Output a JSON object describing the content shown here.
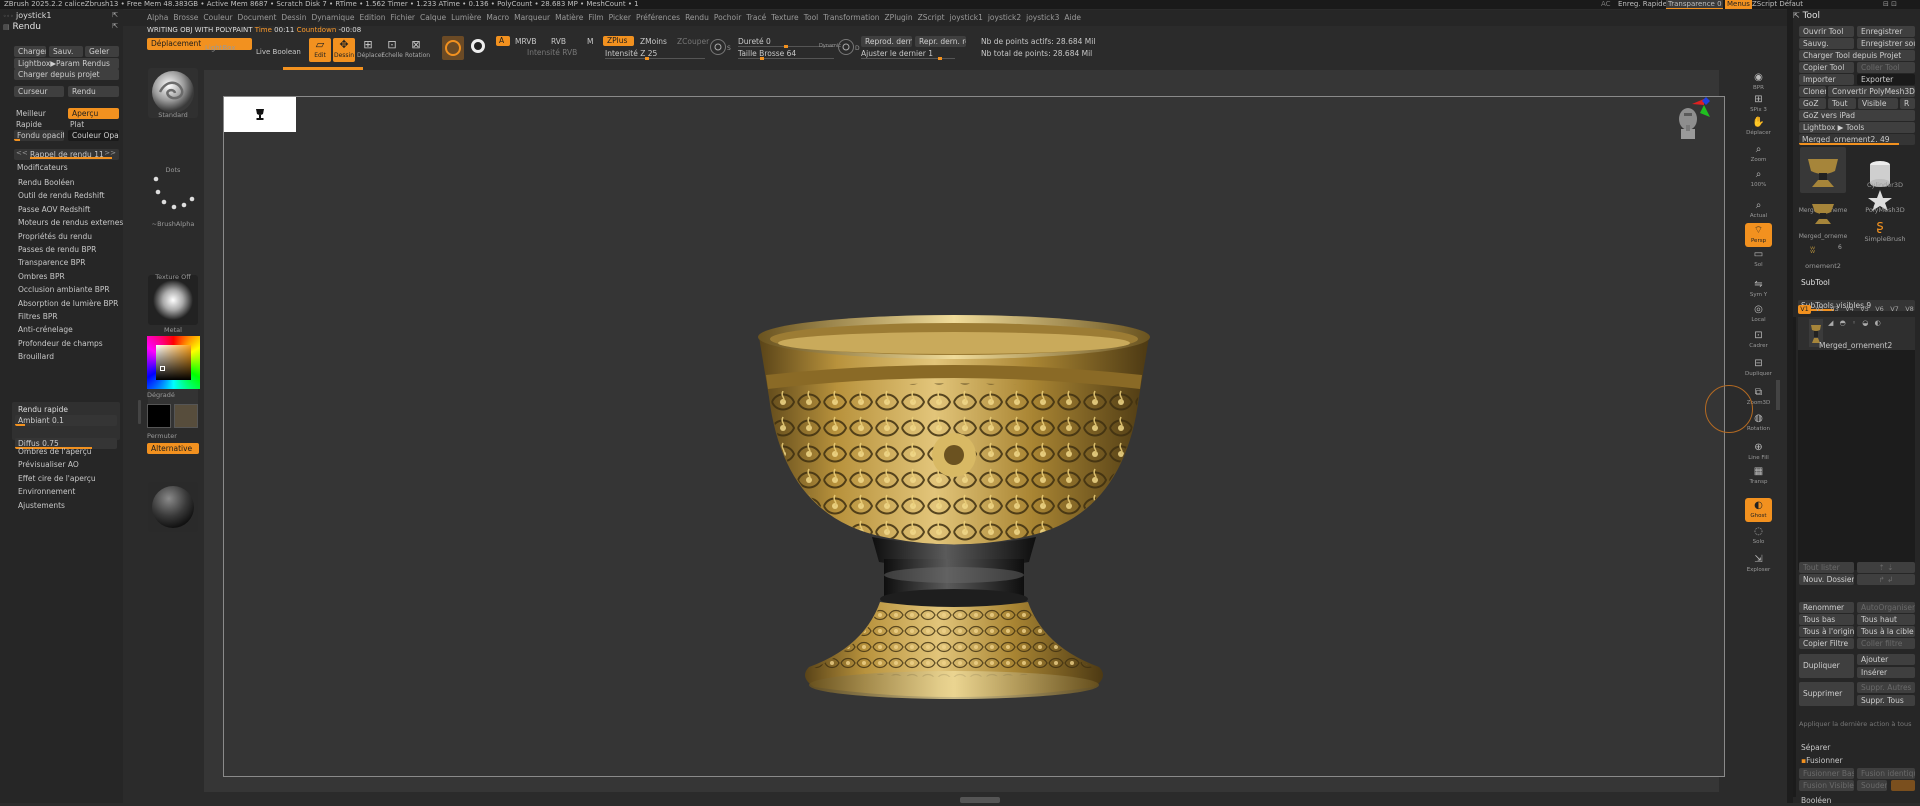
{
  "topbar": {
    "status": "ZBrush 2025.2.2   caliceZbrush13   • Free Mem 48.383GB • Active Mem 8687 • Scratch Disk 7 •  RTime • 1.562 Timer • 1.233 ATime • 0.136 • PolyCount • 28.683 MP • MeshCount • 1",
    "ac": "AC",
    "quicksave": "Enreg. Rapide",
    "transparency": "Transparence 0",
    "menus": "Menus",
    "script": "ZScript Défaut"
  },
  "menubar": {
    "items": [
      "Alpha",
      "Brosse",
      "Couleur",
      "Document",
      "Dessin",
      "Dynamique",
      "Edition",
      "Fichier",
      "Calque",
      "Lumière",
      "Macro",
      "Marqueur",
      "Matière",
      "Film",
      "Picker",
      "Préférences",
      "Rendu",
      "Pochoir",
      "Tracé",
      "Texture",
      "Tool",
      "Transformation",
      "ZPlugin",
      "ZScript",
      "joystick1",
      "joystick2",
      "joystick3",
      "Aide"
    ]
  },
  "statusline": {
    "text": "WRITING OBJ WITH POLYPAINT",
    "time_label": "Time",
    "time_value": "00:11",
    "countdown_label": "Countdown",
    "countdown_value": "-00:08"
  },
  "left_panel": {
    "plugin_name": "joystick1",
    "title": "Rendu",
    "buttons": {
      "charger": "Charger",
      "sauvegarder": "Sauv.",
      "geler": "Geler",
      "lightbox": "Lightbox▶Param Rendus",
      "charger_projet": "Charger depuis projet"
    },
    "mode_labels": {
      "curseur": "Curseur",
      "rendu": "Rendu"
    },
    "quality": {
      "meilleur": "Meilleur",
      "apercu": "Aperçu",
      "rapide": "Rapide",
      "plat": "Plat",
      "fondu": "Fondu opacité",
      "couleur_opac": "Couleur Opac."
    },
    "rappel": "Rappel de rendu 11",
    "rappel_level": 0.95,
    "modificateurs": "Modificateurs",
    "sections": [
      "Rendu Booléen",
      "Outil de rendu Redshift",
      "Passe AOV Redshift",
      "Moteurs de rendus externes",
      "Propriétés du rendu",
      "Passes de rendu BPR",
      "Transparence BPR",
      "Ombres BPR",
      "Occlusion ambiante BPR",
      "Absorption de lumière BPR",
      "Filtres BPR",
      "Anti-crénelage",
      "Profondeur de champs",
      "Brouillard"
    ],
    "rendu_rapide": "Rendu rapide",
    "ambiant": "Ambiant 0.1",
    "ambiant_level": 0.1,
    "diffus": "Diffus 0.75",
    "diffus_level": 0.75,
    "sections2": [
      "Ombres de l'aperçu",
      "Prévisualiser AO",
      "Effet cire de l'aperçu",
      "Environnement",
      "Ajustements"
    ]
  },
  "brush_column": {
    "deplacement": "Déplacement",
    "brushes": [
      {
        "name": "Standard"
      },
      {
        "name": "Dots"
      },
      {
        "name": "~BrushAlpha"
      },
      {
        "name": "Texture Off"
      },
      {
        "name": "Metal"
      }
    ],
    "degrade": "Dégradé",
    "permuter": "Permuter",
    "alternative": "Alternative",
    "colors": {
      "primary": "#000000",
      "secondary": "#574d3c",
      "accent": "#f2911f"
    }
  },
  "toolbar": {
    "lightbox": "LightBox",
    "live_boolean": "Live Boolean",
    "edit": "Edit",
    "dessin": "Dessin",
    "deplacer": "Déplacer",
    "echelle": "Echelle",
    "rotation": "Rotation",
    "a_label": "A",
    "mrvb": "MRVB",
    "rvb": "RVB",
    "m": "M",
    "zplus": "ZPlus",
    "zmoins": "ZMoins",
    "zcouper": "ZCouper",
    "intensite_rvb": "Intensité RVB",
    "intensite_z": "Intensité Z 25",
    "durete": "Dureté 0",
    "taille_brosse": "Taille Brosse 64",
    "dynamique": "Dynamic",
    "reprod_dernier": "Reprod. dernier",
    "repr_dern_rel": "Repr. dern. rel.",
    "ajuster": "Ajuster le dernier 1",
    "points_actifs": "Nb de points actifs: 28.684 Mil",
    "points_total": "Nb total de points: 28.684 Mil"
  },
  "canvas": {
    "icon": "chalice-icon"
  },
  "right_shelf": {
    "items": [
      "BPR",
      "SPix 3",
      "Déplacer",
      "Zoom",
      "100%",
      "Actual",
      "Persp",
      "Sol",
      "Sym Y",
      "Local",
      "Cadrer",
      "Dupliquer",
      "Zoom3D",
      "Rotation",
      "Line Fill",
      "Transp",
      "Ghost",
      "Solo",
      "Exploser"
    ]
  },
  "tool_panel": {
    "title": "Tool",
    "open_tool": "Ouvrir Tool",
    "save": "Enregistrer",
    "save_as": "Sauvg.",
    "save_as_full": "Enregistrer sous",
    "load_project": "Charger Tool depuis Projet",
    "copy_tool": "Copier Tool",
    "paste_tool": "Coller Tool",
    "import": "Importer",
    "export": "Exporter",
    "clone": "Cloner",
    "convert": "Convertir PolyMesh3D",
    "goz": "GoZ",
    "all": "Tout",
    "visible": "Visible",
    "r": "R",
    "goz_ipad": "GoZ vers iPad",
    "lightbox_tools": "Lightbox ▶ Tools",
    "current_tool": "Merged_ornement2. 49",
    "tools": [
      "Merged_orneme",
      "Cylinder3D",
      "Merged_orneme",
      "PolyMesh3D",
      "SimpleBrush",
      "ornement2"
    ],
    "tool_count": "6",
    "subtool": "SubTool",
    "subtools_visible": "SubTools visibles 9",
    "versions": [
      "V1",
      "V2",
      "V3",
      "V4",
      "V5",
      "V6",
      "V7",
      "V8"
    ],
    "subtool_item": "Merged_ornement2",
    "list_all": "Tout lister",
    "new_folder": "Nouv. Dossier",
    "rename": "Renommer",
    "autoorganize": "AutoOrganiser",
    "all_low": "Tous bas",
    "all_high": "Tous haut",
    "all_origin": "Tous à l'origine",
    "all_target": "Tous à la cible",
    "copy_filter": "Copier Filtre",
    "paste_filter": "Coller filtre",
    "duplicate": "Dupliquer",
    "add": "Ajouter",
    "insert": "Insérer",
    "delete": "Supprimer",
    "delete_others": "Suppr. Autres",
    "delete_all": "Suppr. Tous",
    "apply_last": "Appliquer la dernière action à tous",
    "separate": "Séparer",
    "merge": "Fusionner",
    "merge_down": "Fusionner Bas",
    "merge_similar": "Fusion identique",
    "merge_visible": "Fusion Visible",
    "weld": "Souder",
    "boolean": "Booléen"
  }
}
